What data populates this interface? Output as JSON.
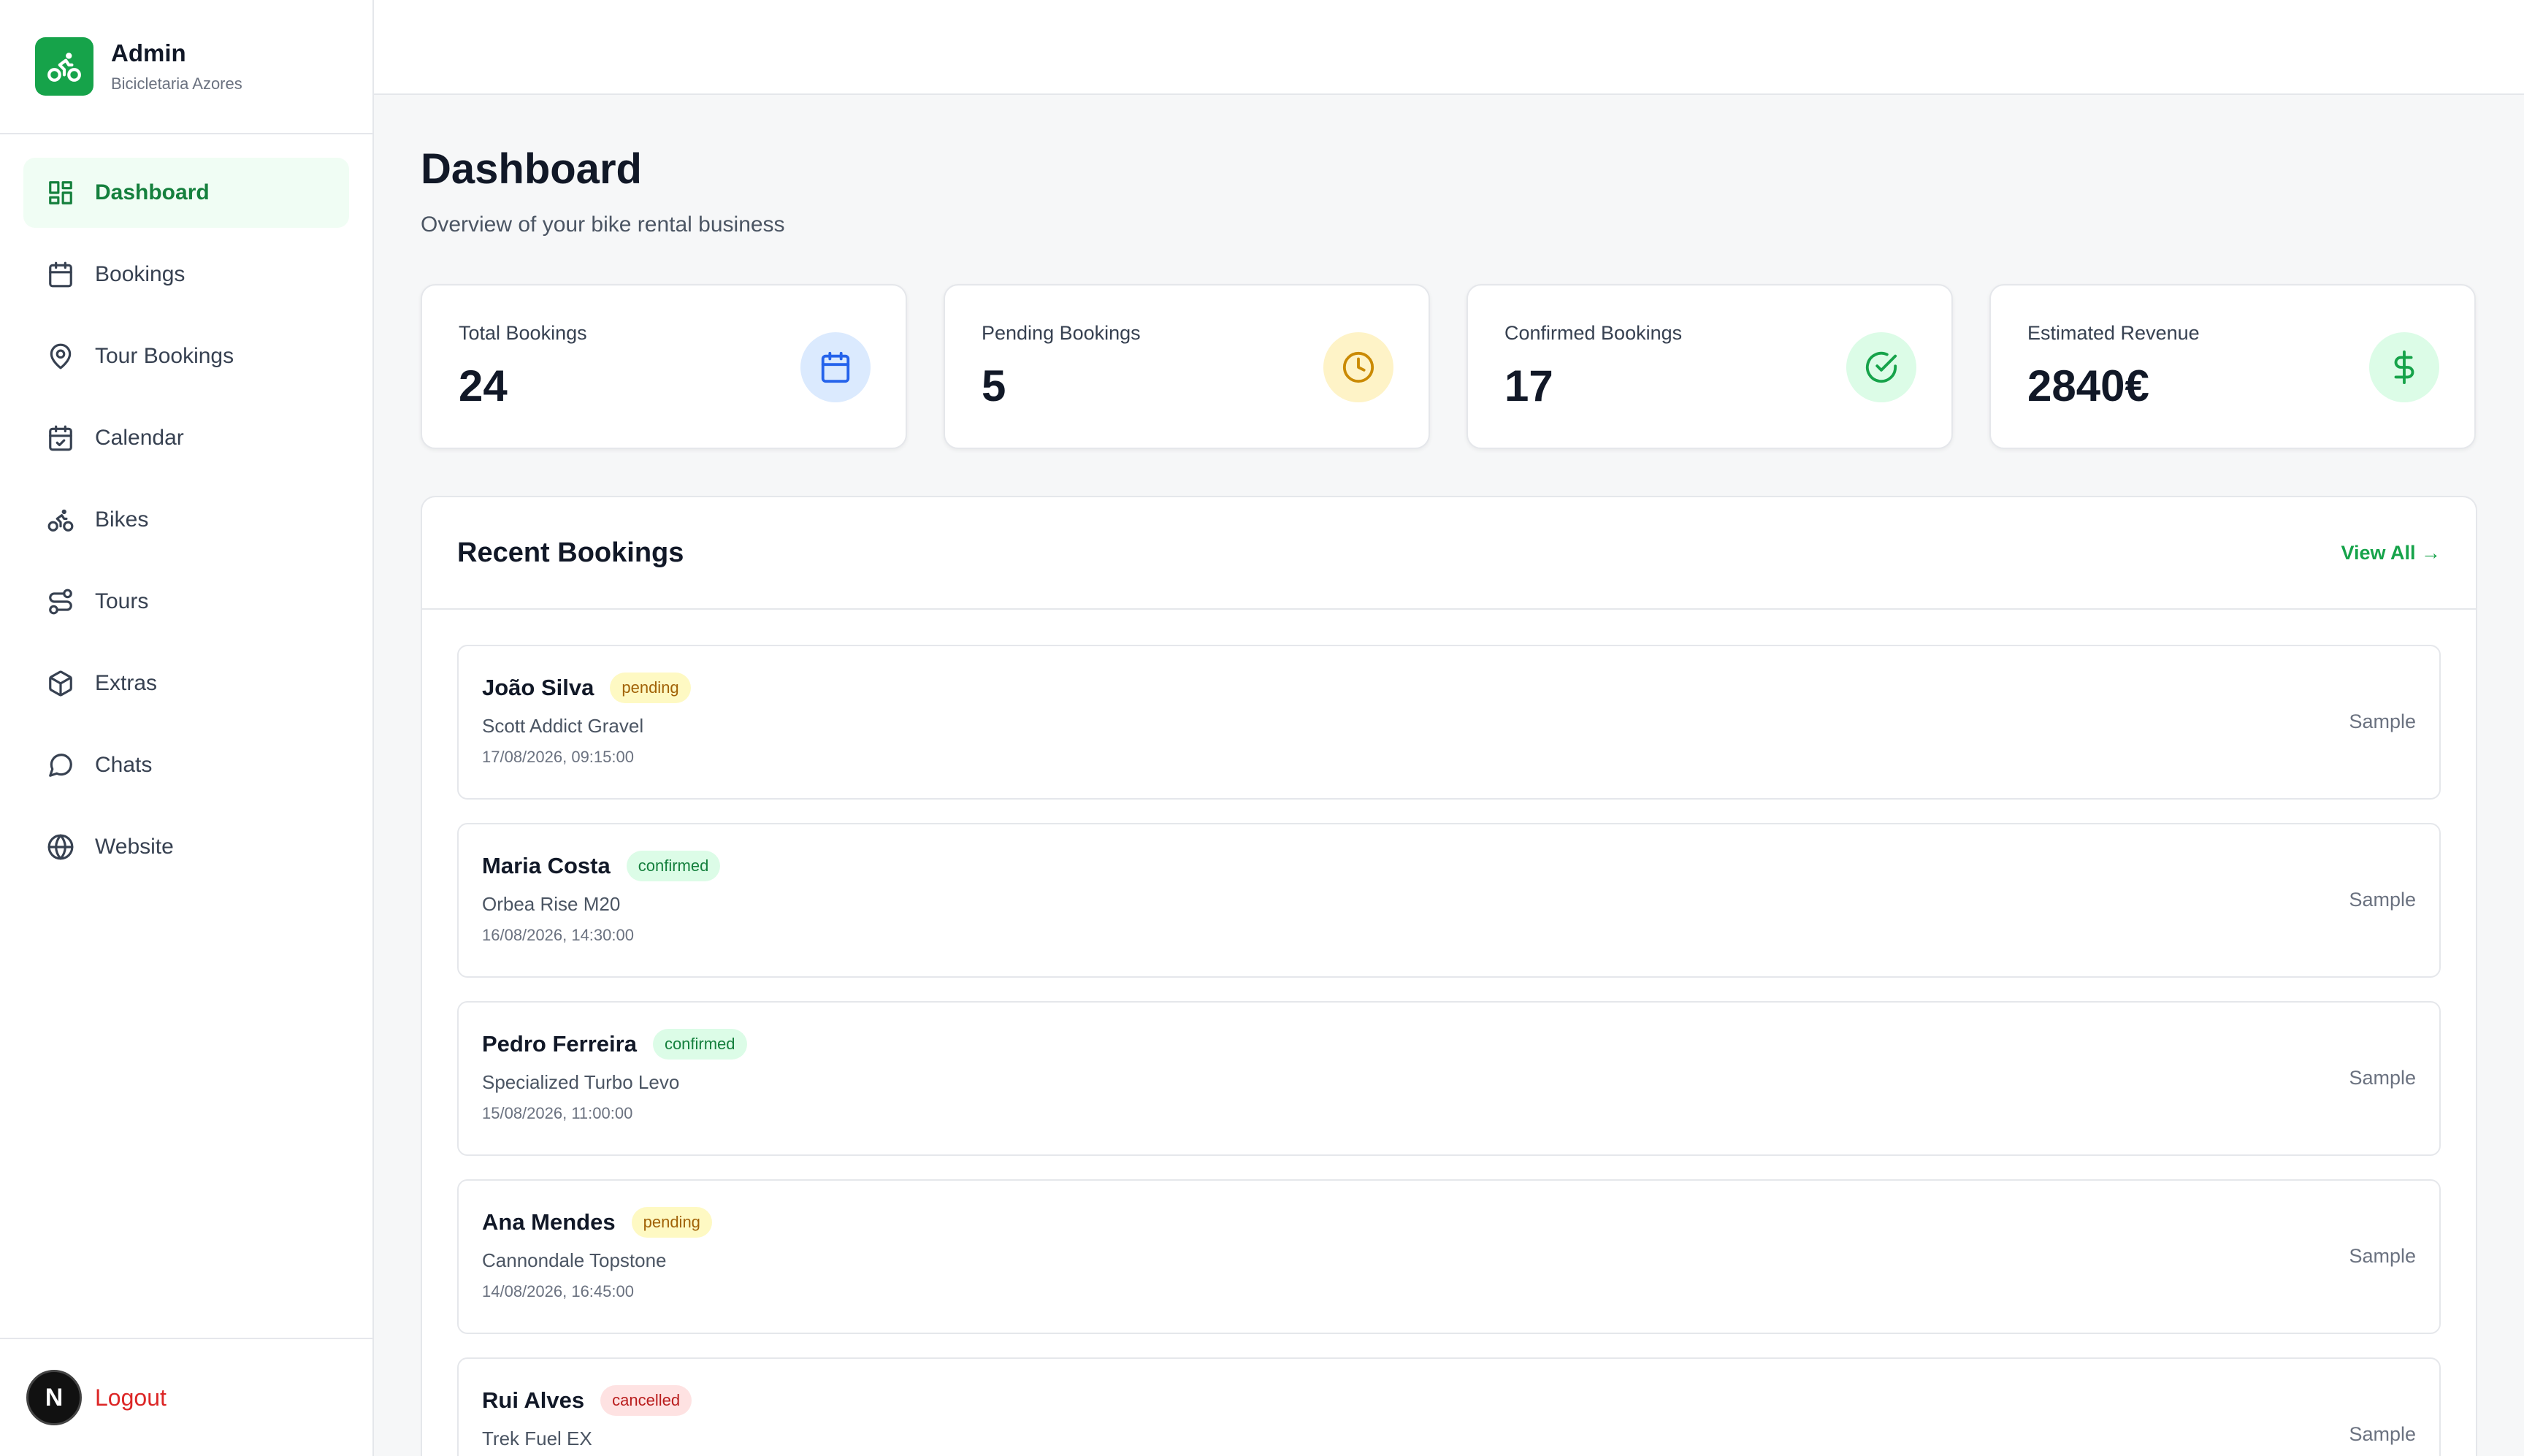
{
  "brand": {
    "title": "Admin",
    "subtitle": "Bicicletaria Azores",
    "accent": "#16a34a",
    "logo_icon": "bicycle-icon"
  },
  "sidebar": {
    "items": [
      {
        "label": "Dashboard",
        "icon": "layout-grid-icon",
        "active": true
      },
      {
        "label": "Bookings",
        "icon": "calendar-icon",
        "active": false
      },
      {
        "label": "Tour Bookings",
        "icon": "map-pin-icon",
        "active": false
      },
      {
        "label": "Calendar",
        "icon": "calendar-check-icon",
        "active": false
      },
      {
        "label": "Bikes",
        "icon": "bike-icon",
        "active": false
      },
      {
        "label": "Tours",
        "icon": "route-icon",
        "active": false
      },
      {
        "label": "Extras",
        "icon": "box-icon",
        "active": false
      },
      {
        "label": "Chats",
        "icon": "message-circle-icon",
        "active": false
      },
      {
        "label": "Website",
        "icon": "globe-icon",
        "active": false
      }
    ],
    "footer": {
      "badge": "N",
      "logout_label": "Logout"
    }
  },
  "page": {
    "title": "Dashboard",
    "subtitle": "Overview of your bike rental business"
  },
  "stats": [
    {
      "label": "Total Bookings",
      "value": "24",
      "icon": "calendar-icon",
      "color": "#2563eb"
    },
    {
      "label": "Pending Bookings",
      "value": "5",
      "icon": "clock-icon",
      "color": "#ca8a04"
    },
    {
      "label": "Confirmed Bookings",
      "value": "17",
      "icon": "check-circle-icon",
      "color": "#16a34a"
    },
    {
      "label": "Estimated Revenue",
      "value": "2840€",
      "icon": "dollar-icon",
      "color": "#16a34a"
    }
  ],
  "recent": {
    "title": "Recent Bookings",
    "view_all": "View All →",
    "bookings": [
      {
        "name": "João Silva",
        "status": "pending",
        "bike": "Scott Addict Gravel",
        "date": "17/08/2026, 09:15:00",
        "source": "Sample"
      },
      {
        "name": "Maria Costa",
        "status": "confirmed",
        "bike": "Orbea Rise M20",
        "date": "16/08/2026, 14:30:00",
        "source": "Sample"
      },
      {
        "name": "Pedro Ferreira",
        "status": "confirmed",
        "bike": "Specialized Turbo Levo",
        "date": "15/08/2026, 11:00:00",
        "source": "Sample"
      },
      {
        "name": "Ana Mendes",
        "status": "pending",
        "bike": "Cannondale Topstone",
        "date": "14/08/2026, 16:45:00",
        "source": "Sample"
      },
      {
        "name": "Rui Alves",
        "status": "cancelled",
        "bike": "Trek Fuel EX",
        "date": "",
        "source": "Sample"
      }
    ]
  }
}
